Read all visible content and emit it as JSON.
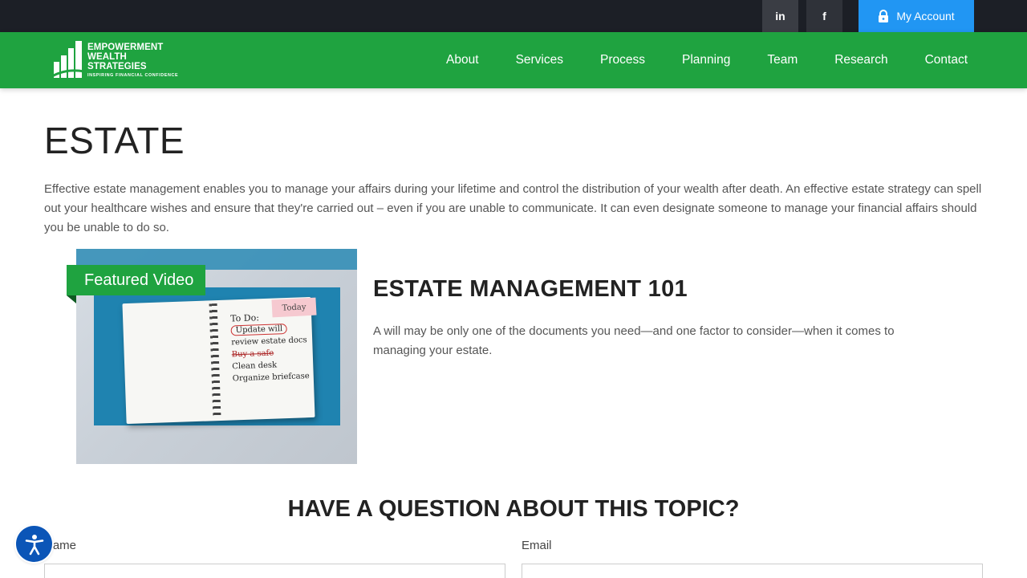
{
  "topbar": {
    "linkedin": "in",
    "facebook": "f",
    "account_label": "My Account"
  },
  "logo": {
    "line1": "EMPOWERMENT",
    "line2": "WEALTH",
    "line3": "STRATEGIES",
    "tagline": "INSPIRING FINANCIAL CONFIDENCE"
  },
  "nav": [
    "About",
    "Services",
    "Process",
    "Planning",
    "Team",
    "Research",
    "Contact"
  ],
  "page": {
    "title": "ESTATE",
    "intro": "Effective estate management enables you to manage your affairs during your lifetime and control the distribution of your wealth after death. An effective estate strategy can spell out your healthcare wishes and ensure that they're carried out – even if you are unable to communicate. It can even designate someone to manage your financial affairs should you be unable to do so."
  },
  "video": {
    "badge": "Featured Video",
    "sticky": "Today",
    "todo": [
      "To Do:",
      "Update will",
      "review estate docs",
      "Buy a safe",
      "Clean desk",
      "Organize briefcase"
    ],
    "title": "ESTATE MANAGEMENT 101",
    "description": "A will may be only one of the documents you need—and one factor to consider—when it comes to managing your estate."
  },
  "form": {
    "title": "HAVE A QUESTION ABOUT THIS TOPIC?",
    "name_label": "Name",
    "email_label": "Email"
  },
  "colors": {
    "brand_green": "#1fa340",
    "topbar": "#1c1f26",
    "account_blue": "#2196f3",
    "a11y_blue": "#0b55b7"
  },
  "icons": {
    "account": "lock-icon",
    "accessibility": "accessibility-person-icon"
  }
}
